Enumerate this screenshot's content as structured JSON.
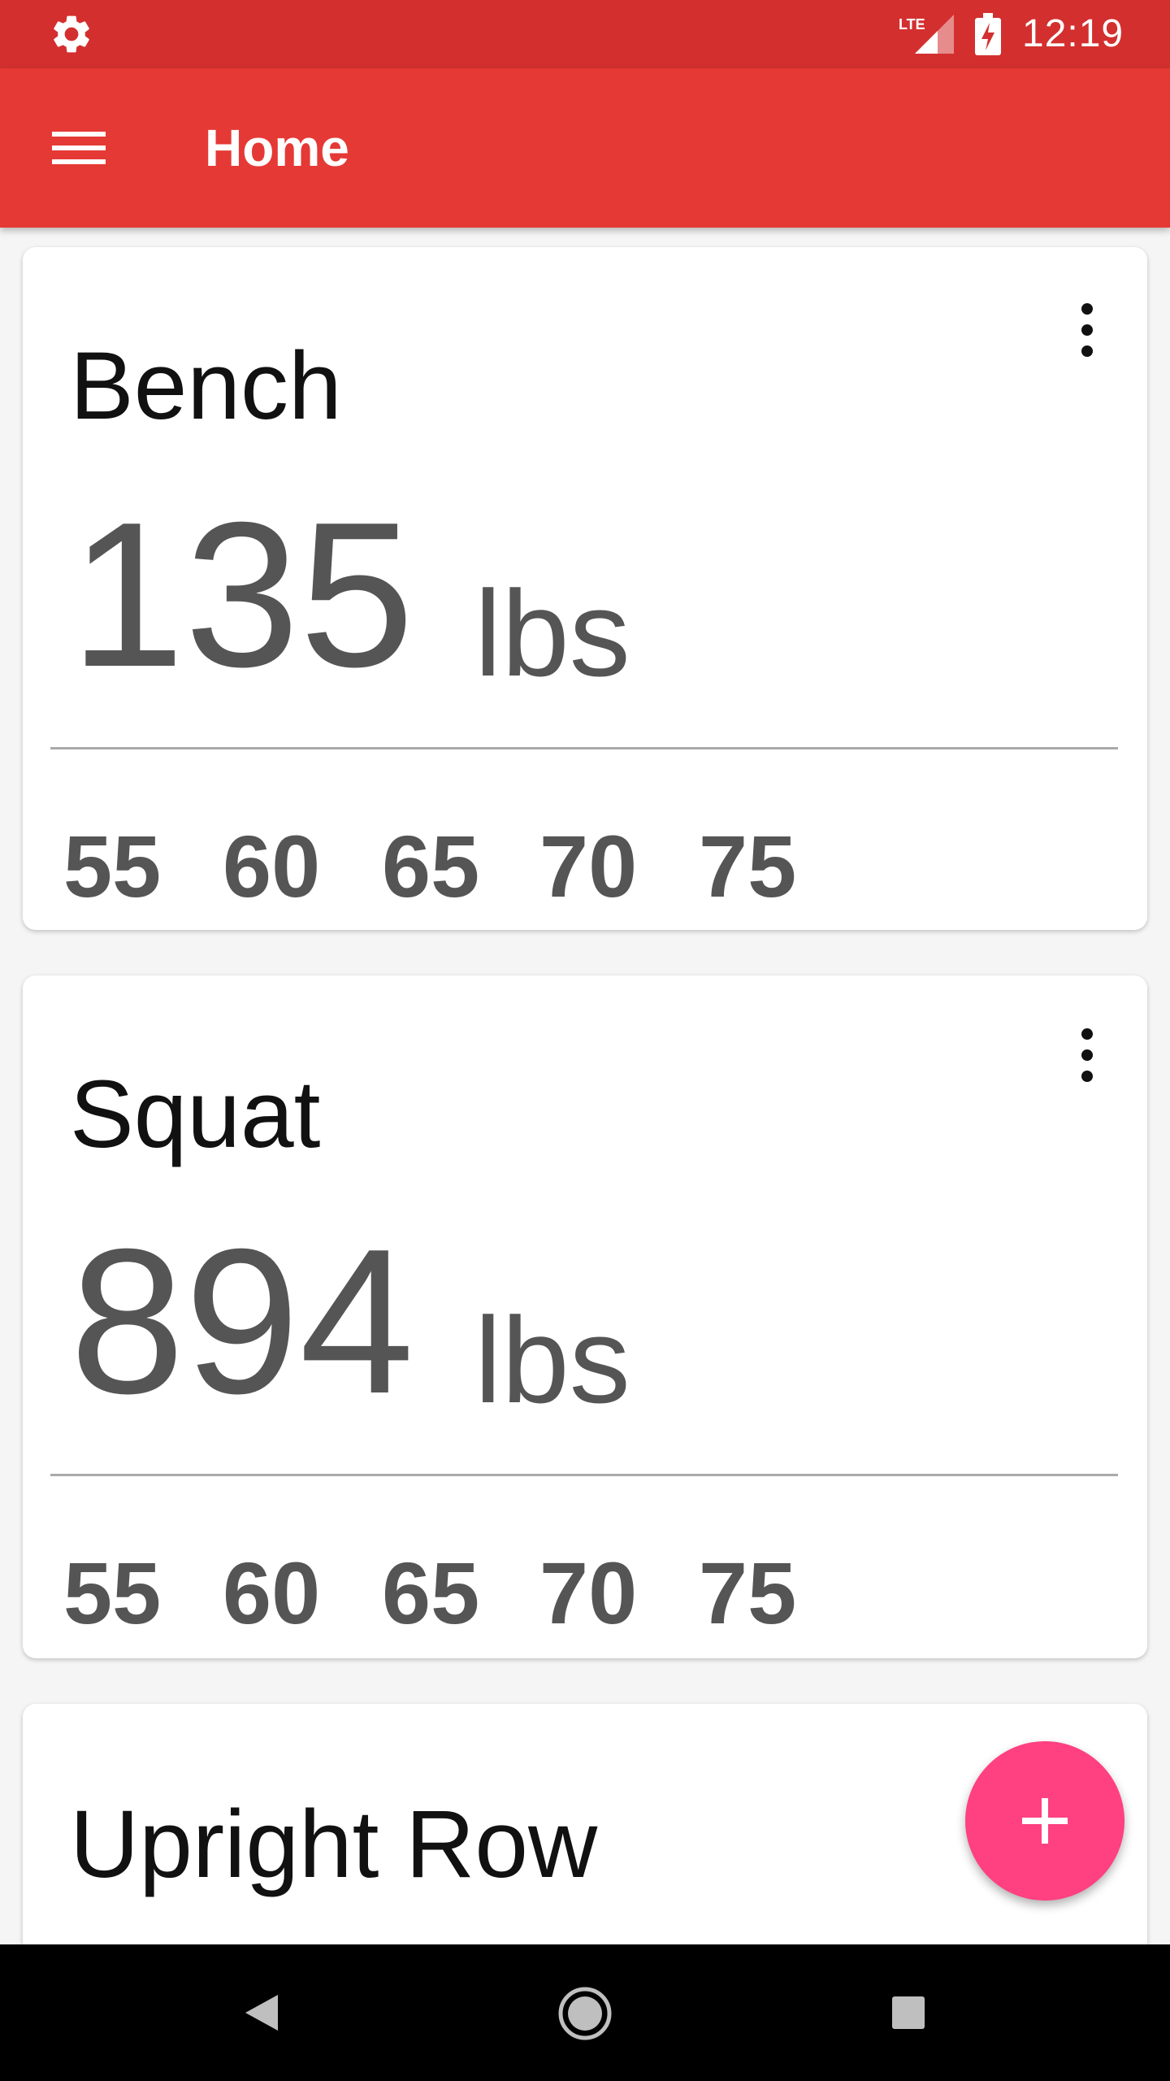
{
  "status_bar": {
    "time": "12:19",
    "network": "LTE",
    "icons": [
      "settings-gear-icon",
      "lte-signal-icon",
      "battery-charging-icon"
    ]
  },
  "app_bar": {
    "title": "Home",
    "menu_icon": "hamburger-menu-icon",
    "color": "#E53935"
  },
  "cards": [
    {
      "name": "Bench",
      "value": "135",
      "unit": "lbs",
      "weights": [
        "55",
        "60",
        "65",
        "70",
        "75"
      ]
    },
    {
      "name": "Squat",
      "value": "894",
      "unit": "lbs",
      "weights": [
        "55",
        "60",
        "65",
        "70",
        "75"
      ]
    },
    {
      "name": "Upright Row"
    }
  ],
  "fab": {
    "icon": "plus-icon",
    "color": "#FF4081"
  },
  "nav_bar": {
    "icons": [
      "back-icon",
      "home-icon",
      "recents-icon"
    ]
  }
}
